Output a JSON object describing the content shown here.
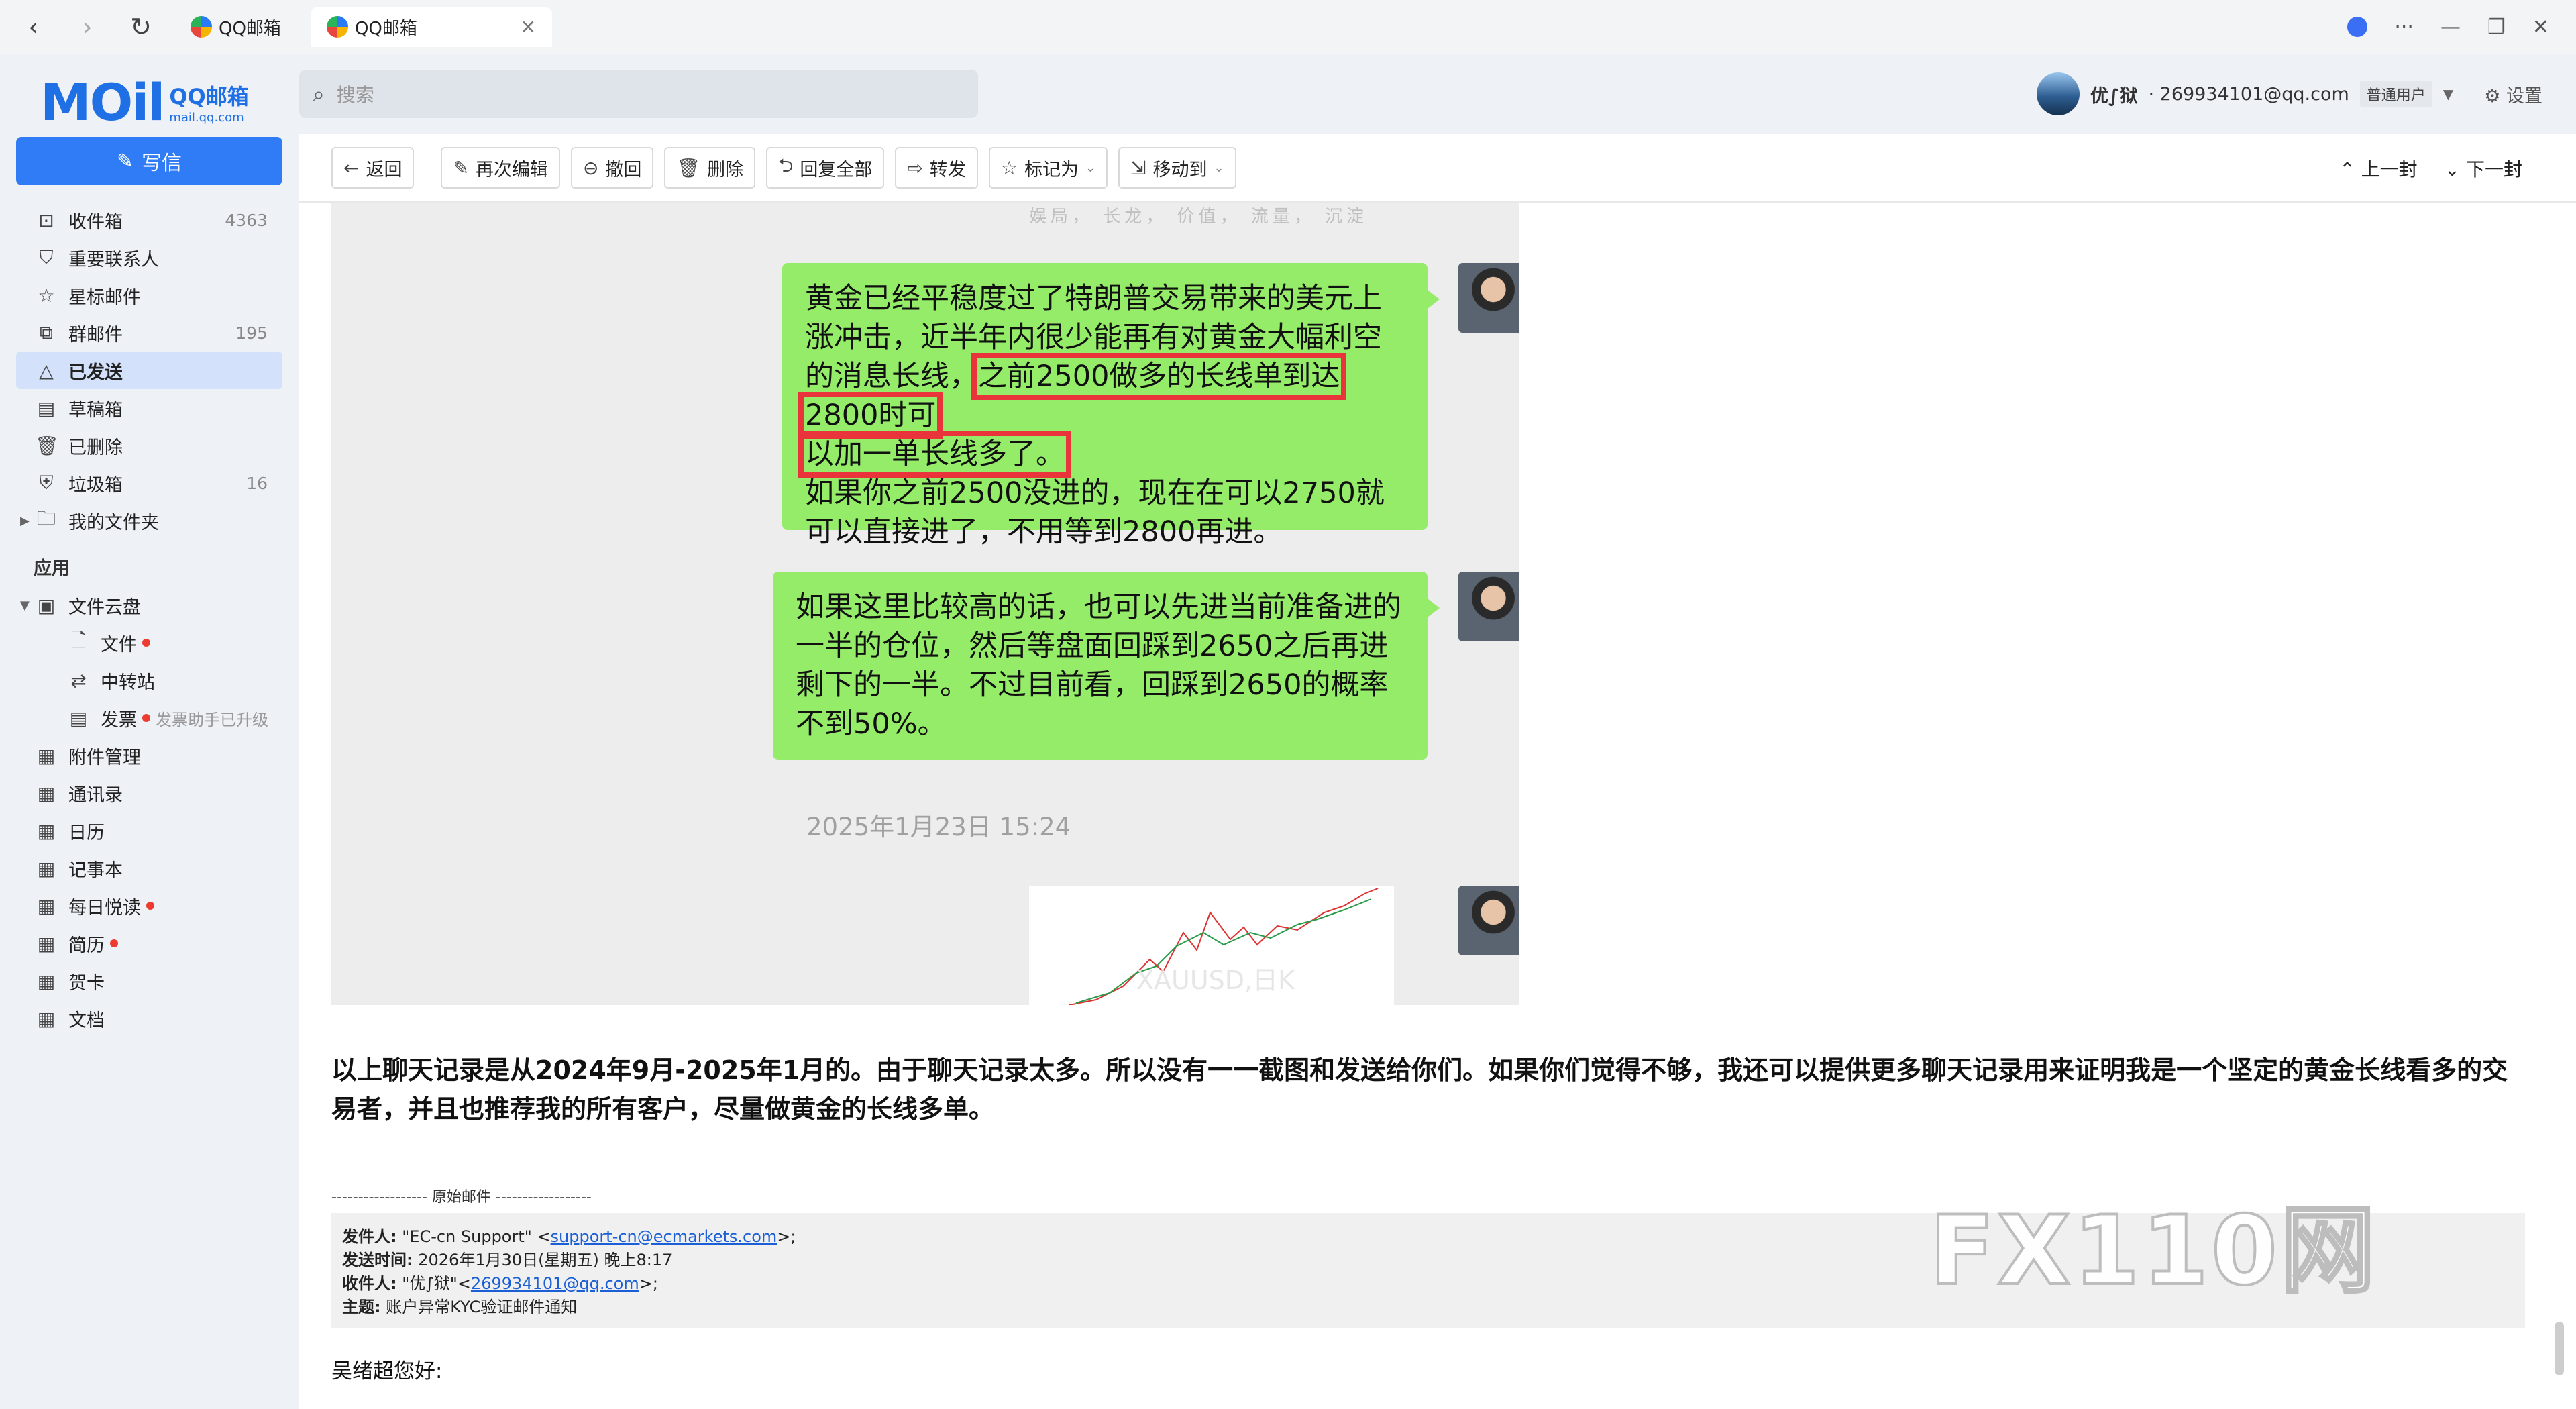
{
  "browser": {
    "tabs": [
      {
        "label": "QQ邮箱"
      },
      {
        "label": "QQ邮箱"
      }
    ],
    "menu_glyph": "···"
  },
  "app": {
    "logo_main": "MOil",
    "logo_cn": "QQ邮箱",
    "logo_domain": "mail.qq.com",
    "compose_label": "写信"
  },
  "search": {
    "placeholder": "搜索"
  },
  "user": {
    "name": "优∫狱",
    "email": " · 269934101@qq.com",
    "badge": "普通用户",
    "settings": "设置"
  },
  "sidebar": {
    "folders": [
      {
        "label": "收件箱",
        "count": "4363",
        "icon": "inbox-icon"
      },
      {
        "label": "重要联系人",
        "count": "",
        "icon": "bookmark-icon"
      },
      {
        "label": "星标邮件",
        "count": "",
        "icon": "star-icon"
      },
      {
        "label": "群邮件",
        "count": "195",
        "icon": "group-mail-icon"
      },
      {
        "label": "已发送",
        "count": "",
        "icon": "sent-icon"
      },
      {
        "label": "草稿箱",
        "count": "",
        "icon": "draft-icon"
      },
      {
        "label": "已删除",
        "count": "",
        "icon": "trash-icon"
      },
      {
        "label": "垃圾箱",
        "count": "16",
        "icon": "shield-icon"
      },
      {
        "label": "我的文件夹",
        "count": "",
        "icon": "folder-icon"
      }
    ],
    "apps_title": "应用",
    "apps": {
      "cloud": "文件云盘",
      "files": "文件",
      "transfer": "中转站",
      "invoice": "发票",
      "invoice_hint": "发票助手已升级",
      "attachments": "附件管理",
      "contacts": "通讯录",
      "calendar": "日历",
      "notes": "记事本",
      "daily": "每日悦读",
      "resume": "简历",
      "card": "贺卡",
      "docs": "文档"
    }
  },
  "toolbar": {
    "back": "返回",
    "reedit": "再次编辑",
    "recall": "撤回",
    "delete": "删除",
    "reply_all": "回复全部",
    "forward": "转发",
    "mark_as": "标记为",
    "move_to": "移动到",
    "prev": "上一封",
    "next": "下一封"
  },
  "chat": {
    "strip_text": "娱局，  长龙，  价值，  流量，  沉淀",
    "msg1_a": "黄金已经平稳度过了特朗普交易带来的美元上涨冲击，近半年内很少能再有对黄金大幅利空的消息长线，",
    "msg1_hl1": "之前2500做多的长线单到达2800时可",
    "msg1_hl2": "以加一单长线多了。",
    "msg1_b": "如果你之前2500没进的，现在在可以2750就可以直接进了，不用等到2800再进。",
    "msg2": "如果这里比较高的话，也可以先进当前准备进的一半的仓位，然后等盘面回踩到2650之后再进剩下的一半。不过目前看，回踩到2650的概率不到50%。",
    "timestamp": "2025年1月23日 15:24",
    "chart_label": "XAUUSD,日K"
  },
  "email": {
    "body": "以上聊天记录是从2024年9月-2025年1月的。由于聊天记录太多。所以没有一一截图和发送给你们。如果你们觉得不够，我还可以提供更多聊天记录用来证明我是一个坚定的黄金长线看多的交易者，并且也推荐我的所有客户，尽量做黄金的长线多单。",
    "original_divider": "------------------ 原始邮件 ------------------",
    "from_label": "发件人:",
    "from_name": " \"EC-cn Support\" <",
    "from_email": "support-cn@ecmarkets.com",
    "from_tail": ">;",
    "sent_label": "发送时间:",
    "sent_value": " 2026年1月30日(星期五) 晚上8:17",
    "to_label": "收件人:",
    "to_name": " \"优∫狱\"<",
    "to_email": "269934101@qq.com",
    "to_tail": ">;",
    "subject_label": "主题:",
    "subject_value": " 账户异常KYC验证邮件通知",
    "greeting": "吴绪超您好:"
  },
  "watermark": "FX110网"
}
